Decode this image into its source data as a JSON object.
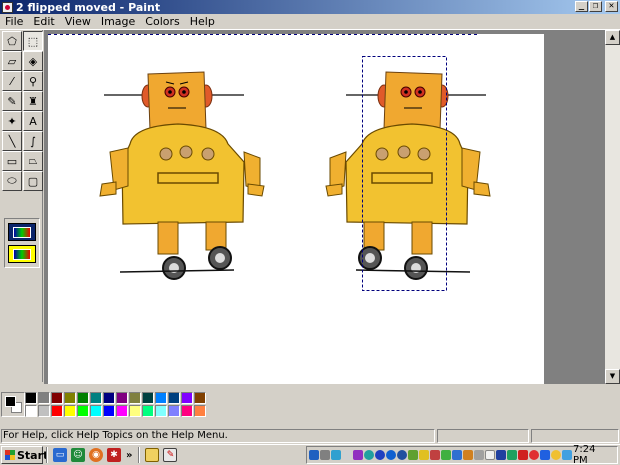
{
  "window": {
    "title": "2 flipped moved - Paint",
    "minimize_label": "_",
    "restore_label": "❐",
    "close_label": "✕"
  },
  "menu": [
    "File",
    "Edit",
    "View",
    "Image",
    "Colors",
    "Help"
  ],
  "tools": [
    {
      "name": "free-form-select-icon",
      "glyph": "⬠"
    },
    {
      "name": "rect-select-icon",
      "glyph": "⬚"
    },
    {
      "name": "eraser-icon",
      "glyph": "▱"
    },
    {
      "name": "fill-bucket-icon",
      "glyph": "◈"
    },
    {
      "name": "color-picker-icon",
      "glyph": "⁄"
    },
    {
      "name": "magnifier-icon",
      "glyph": "⚲"
    },
    {
      "name": "pencil-icon",
      "glyph": "✎"
    },
    {
      "name": "brush-icon",
      "glyph": "♜"
    },
    {
      "name": "airbrush-icon",
      "glyph": "✦"
    },
    {
      "name": "text-icon",
      "glyph": "A"
    },
    {
      "name": "line-icon",
      "glyph": "╲"
    },
    {
      "name": "curve-icon",
      "glyph": "∫"
    },
    {
      "name": "rectangle-icon",
      "glyph": "▭"
    },
    {
      "name": "polygon-icon",
      "glyph": "⏢"
    },
    {
      "name": "ellipse-icon",
      "glyph": "⬭"
    },
    {
      "name": "rounded-rectangle-icon",
      "glyph": "▢"
    }
  ],
  "active_tool": 1,
  "palette": {
    "foreground": "#000000",
    "background": "#ffffff",
    "colors": [
      "#000000",
      "#808080",
      "#800000",
      "#808000",
      "#008000",
      "#008080",
      "#000080",
      "#800080",
      "#808040",
      "#004040",
      "#0080ff",
      "#004080",
      "#8000ff",
      "#804000",
      "#ffffff",
      "#c0c0c0",
      "#ff0000",
      "#ffff00",
      "#00ff00",
      "#00ffff",
      "#0000ff",
      "#ff00ff",
      "#ffff80",
      "#00ff80",
      "#80ffff",
      "#8080ff",
      "#ff0080",
      "#ff8040"
    ]
  },
  "status": {
    "help_text": "For Help, click Help Topics on the Help Menu."
  },
  "taskbar": {
    "start_label": "Start",
    "clock": "7:24 PM",
    "chevron": "»"
  }
}
